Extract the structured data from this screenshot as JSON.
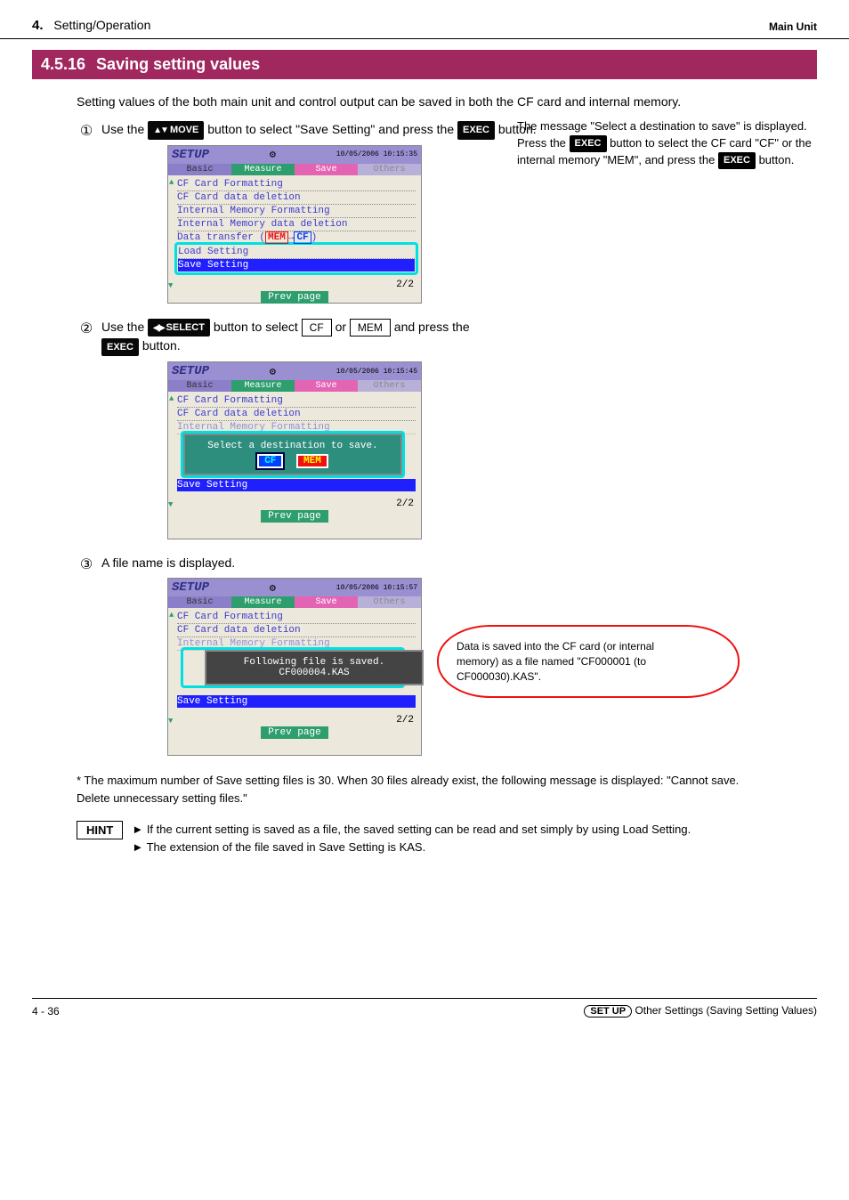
{
  "header": {
    "section_num": "4.",
    "section_title": "Setting/Operation",
    "unit_label": "Main Unit"
  },
  "banner": {
    "num": "4.5.16",
    "title": "Saving setting values"
  },
  "intro": "Setting values of the both main unit and control output can be saved in both the CF card and internal memory.",
  "step1": {
    "pre_text": "Use the ",
    "btn": "MOVE",
    "post_text": " button to select \"Save Setting\" and press the ",
    "exec": "EXEC",
    "end": " button."
  },
  "side_note_text": "The message \"Select a destination to save\" is displayed. Press the          button to select the CF card \"CF\" or the internal memory \"MEM\", and press the          button.",
  "step2": {
    "pre": "Use the ",
    "btn_select": "SELECT",
    "mid1": " button to select ",
    "cf": "CF",
    "or": " or ",
    "mem": "MEM",
    "post": " and press the",
    "exec": "EXEC",
    "end": " button."
  },
  "step3_text": "A file name is displayed.",
  "callout": {
    "l1": "Data is saved into the CF card (or internal",
    "l2": "memory) as a file named \"CF000001 (to",
    "l3": "CF000030).KAS\"."
  },
  "note": "* The maximum number of Save setting files is 30. When 30 files already exist, the following message is displayed: \"Cannot save. Delete unnecessary setting files.\"",
  "hint": {
    "label": "HINT",
    "line1": "► If the current setting is saved as a file, the saved setting can be read and set simply by using Load Setting.",
    "line2": "► The extension of the file saved in Save Setting is KAS."
  },
  "footer": {
    "left_num": "4 - 36",
    "text_after_oval": " Other Settings (Saving Setting Values)"
  },
  "device": {
    "setup_label": "SETUP",
    "time1": "10/05/2006\n10:15:35",
    "time2": "10/05/2006\n10:15:45",
    "time3": "10/05/2006\n10:15:57",
    "tabs": [
      "Basic",
      "Measure",
      "Save",
      "Others"
    ],
    "rows": [
      "CF Card Formatting",
      "CF Card data deletion",
      "Internal Memory Formatting",
      "Internal Memory data deletion",
      "Data transfer"
    ],
    "row_load": "Load Setting",
    "row_save": "Save Setting",
    "pager": "2/2",
    "prev": "Prev page",
    "popup_msg": "Select a destination to save.",
    "popup_cf": "CF",
    "popup_mem": "MEM",
    "popup_file_l1": "Following file is saved.",
    "popup_file_l2": "CF000004.KAS",
    "transfer_mem": "MEM",
    "transfer_cf": "CF"
  }
}
